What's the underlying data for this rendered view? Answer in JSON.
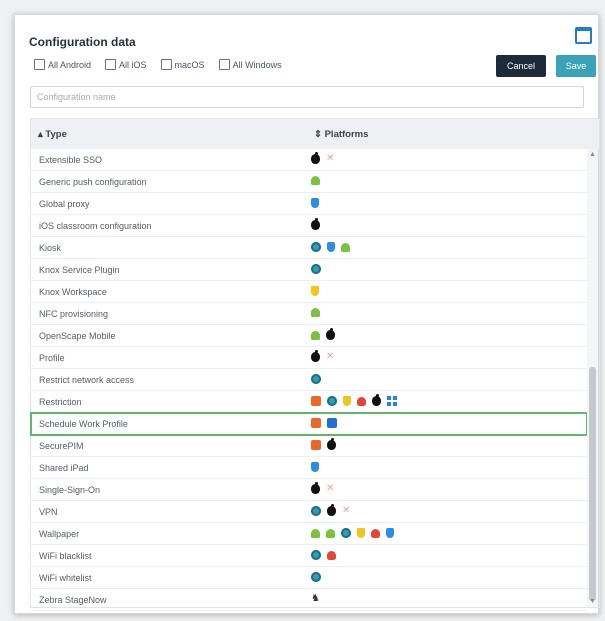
{
  "dialog": {
    "title": "Configuration data",
    "window_icon": "window-maximize-icon"
  },
  "filters": [
    {
      "label": "All Android",
      "checked": false
    },
    {
      "label": "All iOS",
      "checked": false
    },
    {
      "label": "macOS",
      "checked": false
    },
    {
      "label": "All Windows",
      "checked": false
    }
  ],
  "buttons": {
    "cancel_label": "Cancel",
    "save_label": "Save"
  },
  "search": {
    "placeholder": "Configuration name",
    "value": ""
  },
  "table": {
    "columns": [
      {
        "label": "▴ Type",
        "sorted": "ascending"
      },
      {
        "label": "⇕ Platforms"
      }
    ],
    "highlighted_row": "Schedule Work Profile",
    "rows": [
      {
        "name": "Extensible SSO",
        "icons": [
          "apple",
          "x"
        ]
      },
      {
        "name": "Generic push configuration",
        "icons": [
          "android"
        ]
      },
      {
        "name": "Global proxy",
        "icons": [
          "ios"
        ]
      },
      {
        "name": "iOS classroom configuration",
        "icons": [
          "apple"
        ]
      },
      {
        "name": "Kiosk",
        "icons": [
          "circle-teal",
          "ios",
          "android"
        ]
      },
      {
        "name": "Knox Service Plugin",
        "icons": [
          "circle-teal"
        ]
      },
      {
        "name": "Knox Workspace",
        "icons": [
          "shield"
        ]
      },
      {
        "name": "NFC provisioning",
        "icons": [
          "android"
        ]
      },
      {
        "name": "OpenScape Mobile",
        "icons": [
          "android",
          "apple"
        ]
      },
      {
        "name": "Profile",
        "icons": [
          "apple",
          "x"
        ]
      },
      {
        "name": "Restrict network access",
        "icons": [
          "circle-teal"
        ]
      },
      {
        "name": "Restriction",
        "icons": [
          "tool",
          "circle-teal",
          "shield",
          "flame",
          "apple",
          "windows"
        ]
      },
      {
        "name": "Schedule Work Profile",
        "icons": [
          "tool",
          "case"
        ]
      },
      {
        "name": "SecurePIM",
        "icons": [
          "tool",
          "apple"
        ]
      },
      {
        "name": "Shared iPad",
        "icons": [
          "ios"
        ]
      },
      {
        "name": "Single-Sign-On",
        "icons": [
          "apple",
          "x"
        ]
      },
      {
        "name": "VPN",
        "icons": [
          "circle-teal",
          "apple",
          "x"
        ]
      },
      {
        "name": "Wallpaper",
        "icons": [
          "android",
          "android",
          "circle-teal",
          "shield",
          "flame",
          "ios"
        ]
      },
      {
        "name": "WiFi blacklist",
        "icons": [
          "circle-teal",
          "flame"
        ]
      },
      {
        "name": "WiFi whitelist",
        "icons": [
          "circle-teal"
        ]
      },
      {
        "name": "Zebra StageNow",
        "icons": [
          "zebra"
        ]
      }
    ]
  },
  "icon_glyphs": {
    "x": "✕",
    "zebra": "♞"
  },
  "colors": {
    "cancel_button": "#1c2a3a",
    "save_button": "#3ba3b8",
    "highlight_outline": "#62b66a"
  }
}
